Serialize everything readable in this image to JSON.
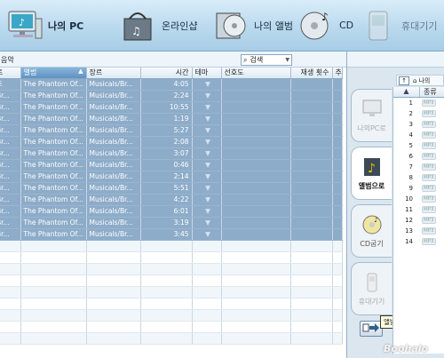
{
  "toolbar": {
    "items": [
      {
        "label": "나의 PC",
        "icon": "monitor-icon",
        "active": true
      },
      {
        "label": "온라인샵",
        "icon": "shopping-bag-icon",
        "active": false
      },
      {
        "label": "나의 앨범",
        "icon": "cd-case-icon",
        "active": false
      },
      {
        "label": "CD",
        "icon": "cd-music-icon",
        "active": false
      },
      {
        "label": "휴대기기",
        "icon": "portable-device-icon",
        "active": false
      }
    ]
  },
  "subbar": {
    "title": "음악",
    "search_label": "검색"
  },
  "table": {
    "columns": [
      "트",
      "앨범",
      "장르",
      "시간",
      "테마",
      "선호도",
      "재생 횟수",
      "추"
    ],
    "rows": [
      {
        "track": "트",
        "title": "The Phantom Of...",
        "genre": "Musicals/Br...",
        "time": "4:05"
      },
      {
        "track": "Br...",
        "title": "The Phantom Of...",
        "genre": "Musicals/Br...",
        "time": "2:24"
      },
      {
        "track": "Br...",
        "title": "The Phantom Of...",
        "genre": "Musicals/Br...",
        "time": "10:55"
      },
      {
        "track": "Br...",
        "title": "The Phantom Of...",
        "genre": "Musicals/Br...",
        "time": "1:19"
      },
      {
        "track": "Br...",
        "title": "The Phantom Of...",
        "genre": "Musicals/Br...",
        "time": "5:27"
      },
      {
        "track": "Br...",
        "title": "The Phantom Of...",
        "genre": "Musicals/Br...",
        "time": "2:08"
      },
      {
        "track": "Br...",
        "title": "The Phantom Of...",
        "genre": "Musicals/Br...",
        "time": "3:07"
      },
      {
        "track": "Br...",
        "title": "The Phantom Of...",
        "genre": "Musicals/Br...",
        "time": "0:46"
      },
      {
        "track": "Br...",
        "title": "The Phantom Of...",
        "genre": "Musicals/Br...",
        "time": "2:14"
      },
      {
        "track": "Br...",
        "title": "The Phantom Of...",
        "genre": "Musicals/Br...",
        "time": "5:51"
      },
      {
        "track": "Br...",
        "title": "The Phantom Of...",
        "genre": "Musicals/Br...",
        "time": "4:22"
      },
      {
        "track": "Br...",
        "title": "The Phantom Of...",
        "genre": "Musicals/Br...",
        "time": "6:01"
      },
      {
        "track": "Br...",
        "title": "The Phantom Of...",
        "genre": "Musicals/Br...",
        "time": "3:19"
      },
      {
        "track": "Br...",
        "title": "The Phantom Of...",
        "genre": "Musicals/Br...",
        "time": "3:45"
      }
    ],
    "theme_marker": "▼",
    "empty_rows": 9
  },
  "rightpane": {
    "nav_label": "나의",
    "tabs": [
      {
        "label": "나의PC로",
        "icon": "monitor-icon",
        "active": false,
        "dim": true
      },
      {
        "label": "앨범으로",
        "icon": "album-note-icon",
        "active": true,
        "dim": false
      },
      {
        "label": "CD굽기",
        "icon": "cd-burn-icon",
        "active": false,
        "dim": false
      },
      {
        "label": "휴대기기",
        "icon": "portable-device-icon",
        "active": false,
        "dim": true
      }
    ],
    "list_header": "종류",
    "list_rows": [
      "1",
      "2",
      "3",
      "4",
      "5",
      "6",
      "7",
      "8",
      "9",
      "10",
      "11",
      "12",
      "13",
      "14"
    ],
    "format_tag": "MP3",
    "send_tooltip": "앨범으로 전송",
    "watermark": "Boohalo"
  },
  "colors": {
    "toolbar_bg": "#b9d9ee",
    "selection": "#8dacc9",
    "sorted_header": "#5e92c4"
  }
}
